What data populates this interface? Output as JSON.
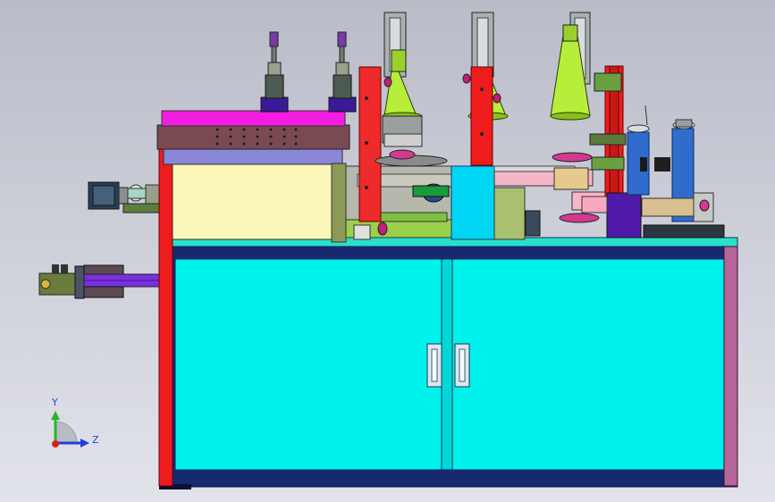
{
  "viewport": {
    "background_top": "#b9bcc7",
    "background_bottom": "#e2e3ea"
  },
  "triad": {
    "y_label": "Y",
    "z_label": "Z",
    "y_color": "#2bb32b",
    "z_color": "#1f3fd8",
    "origin_color": "#d8201c"
  },
  "colors": {
    "cabinet": "#00f4ee",
    "cabinet_frame": "#1a2d7a",
    "red_post": "#ee1c1c",
    "magenta_plate": "#f21de0",
    "brown_plate": "#7a4a52",
    "lavender_plate": "#8a86d8",
    "cream_panel": "#fbf7b8",
    "lime_cone": "#b7ee3c",
    "gray_frame": "#b6b8ad",
    "side_panel": "#b7659a",
    "blue_column": "#2f6ccc",
    "purple_block": "#4f1aa8",
    "pink_rail": "#f6b6c8"
  }
}
